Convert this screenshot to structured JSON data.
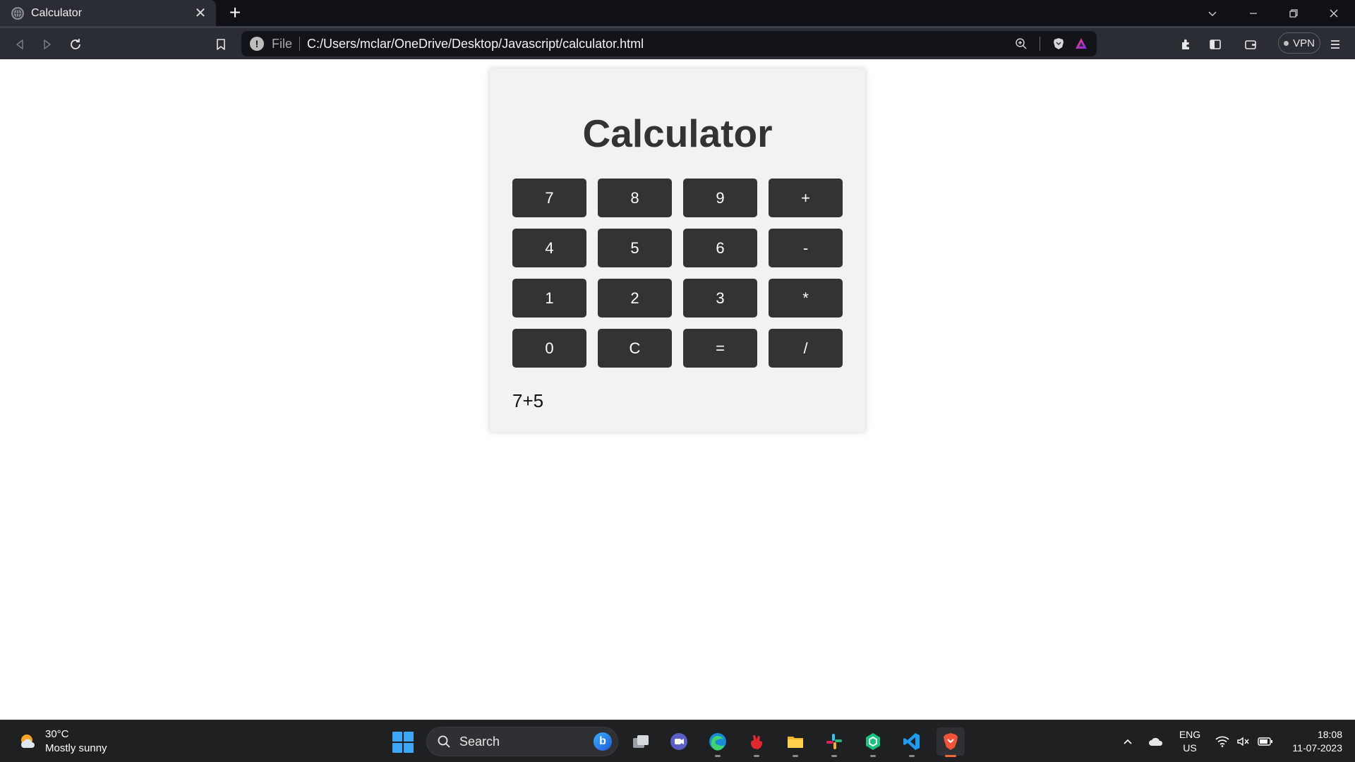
{
  "browser": {
    "tab_title": "Calculator",
    "address": {
      "scheme_label": "File",
      "url": "C:/Users/mclar/OneDrive/Desktop/Javascript/calculator.html"
    },
    "vpn_label": "VPN"
  },
  "page": {
    "title": "Calculator",
    "buttons": [
      [
        "7",
        "8",
        "9",
        "+"
      ],
      [
        "4",
        "5",
        "6",
        "-"
      ],
      [
        "1",
        "2",
        "3",
        "*"
      ],
      [
        "0",
        "C",
        "=",
        "/"
      ]
    ],
    "display": "7+5"
  },
  "taskbar": {
    "weather": {
      "temp": "30°C",
      "desc": "Mostly sunny"
    },
    "search_label": "Search",
    "apps": [
      "task-view",
      "teams-chat",
      "edge",
      "clicker",
      "file-explorer",
      "slack",
      "chatgpt",
      "vscode",
      "brave"
    ],
    "language": {
      "line1": "ENG",
      "line2": "US"
    },
    "clock": {
      "time": "18:08",
      "date": "11-07-2023"
    }
  },
  "colors": {
    "button_bg": "#333333",
    "card_bg": "#f2f2f2",
    "brave_accent": "#f06a3a"
  }
}
